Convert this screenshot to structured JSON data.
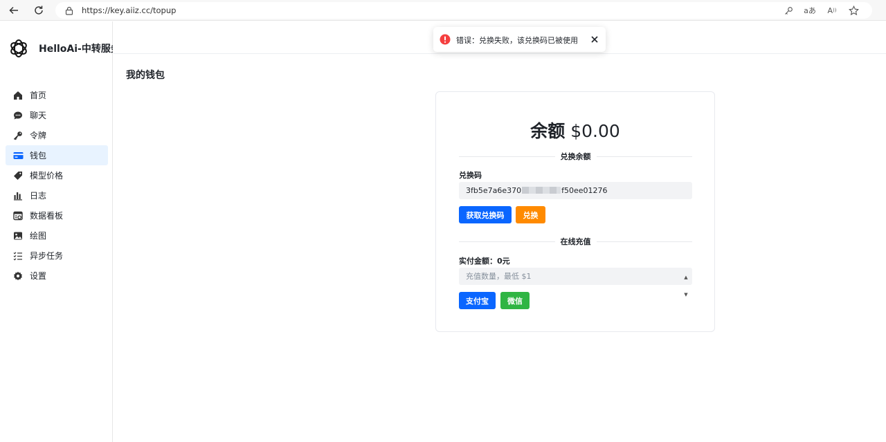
{
  "browser": {
    "url": "https://key.aiiz.cc/topup"
  },
  "brand": {
    "name": "HelloAi-中转服务"
  },
  "sidebar": {
    "items": [
      {
        "label": "首页",
        "icon": "home-icon"
      },
      {
        "label": "聊天",
        "icon": "chat-icon"
      },
      {
        "label": "令牌",
        "icon": "key-icon"
      },
      {
        "label": "钱包",
        "icon": "wallet-icon",
        "active": true
      },
      {
        "label": "模型价格",
        "icon": "tag-icon"
      },
      {
        "label": "日志",
        "icon": "bar-chart-icon"
      },
      {
        "label": "数据看板",
        "icon": "dashboard-icon"
      },
      {
        "label": "绘图",
        "icon": "image-icon"
      },
      {
        "label": "异步任务",
        "icon": "task-list-icon"
      },
      {
        "label": "设置",
        "icon": "gear-icon"
      }
    ]
  },
  "page": {
    "title": "我的钱包"
  },
  "wallet": {
    "balance_label": "余额",
    "balance_value": "$0.00",
    "redeem_section": "兑换余额",
    "redeem_code_label": "兑换码",
    "redeem_code_prefix": "3fb5e7a6e370",
    "redeem_code_suffix": "f50ee01276",
    "get_code_button": "获取兑换码",
    "redeem_button": "兑换",
    "online_section": "在线充值",
    "pay_amount_label": "实付金额：0元",
    "topup_placeholder": "充值数量，最低 $1",
    "alipay_button": "支付宝",
    "wechat_button": "微信"
  },
  "toast": {
    "message": "错误：兑换失败，该兑换码已被使用",
    "type": "error",
    "color": "#f53f3f"
  },
  "colors": {
    "primary": "#0a66ff",
    "orange": "#ff8a00",
    "green": "#2fb543",
    "active_bg": "#e8f3ff"
  }
}
